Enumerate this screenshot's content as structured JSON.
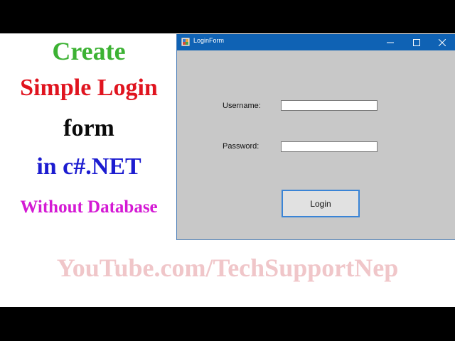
{
  "promo": {
    "lines": [
      {
        "text": "Create",
        "color": "#3cb233"
      },
      {
        "text": "Simple Login",
        "color": "#e0141f"
      },
      {
        "text": "form",
        "color": "#0a0a0a"
      },
      {
        "text": "in c#.NET",
        "color": "#1c1cd0"
      },
      {
        "text": "Without Database",
        "color": "#d41ad4"
      }
    ],
    "watermark": "YouTube.com/TechSupportNep",
    "watermark_color": "#f0c6c9"
  },
  "window": {
    "title": "LoginForm",
    "title_icon": "winforms-app-icon",
    "titlebar_color": "#0f62b4",
    "client_color": "#c8c8c8",
    "controls": {
      "minimize_icon": "minimize-icon",
      "maximize_icon": "maximize-icon",
      "close_icon": "close-icon"
    }
  },
  "form": {
    "username_label": "Username:",
    "username_value": "",
    "password_label": "Password:",
    "password_value": "",
    "login_button_label": "Login",
    "button_border_color": "#3a84d6"
  }
}
